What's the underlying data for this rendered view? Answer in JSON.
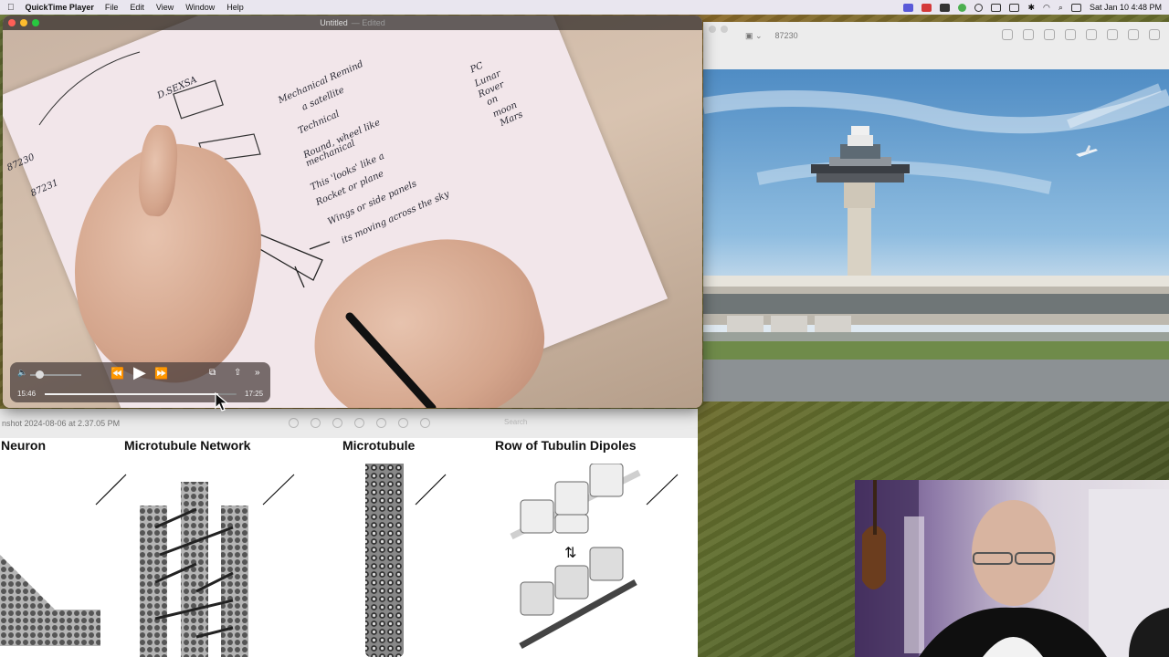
{
  "menubar": {
    "app_name": "QuickTime Player",
    "menus": [
      "File",
      "Edit",
      "View",
      "Window",
      "Help"
    ],
    "clock": "Sat Jan 10  4:48 PM"
  },
  "quicktime": {
    "title": "Untitled",
    "edited": "— Edited",
    "notes": {
      "n1": "D.SEXSA",
      "n2": "Mechanical  Remind",
      "n3": "a  satellite",
      "n4": "Technical",
      "n5": "Round, wheel like",
      "n6": "mechanical",
      "n7": "This 'looks' like a",
      "n8": "Rocket or plane",
      "n9": "Wings or side panels",
      "n10": "its moving across the sky",
      "n11": "PC",
      "n12": "Lunar",
      "n13": "Rover",
      "n14": "on",
      "n15": "moon",
      "n16": "Mars",
      "n17": "87230",
      "n18": "87231"
    },
    "controls": {
      "current_time": "15:46",
      "duration": "17:25",
      "progress": 0.905
    }
  },
  "preview_airport": {
    "title": "87230"
  },
  "preview_microtubule": {
    "title": "nshot 2024-08-06 at 2.37.05 PM",
    "search": "Search",
    "headings": [
      "Neuron",
      "Microtubule Network",
      "Microtubule",
      "Row of Tubulin Dipoles"
    ]
  }
}
